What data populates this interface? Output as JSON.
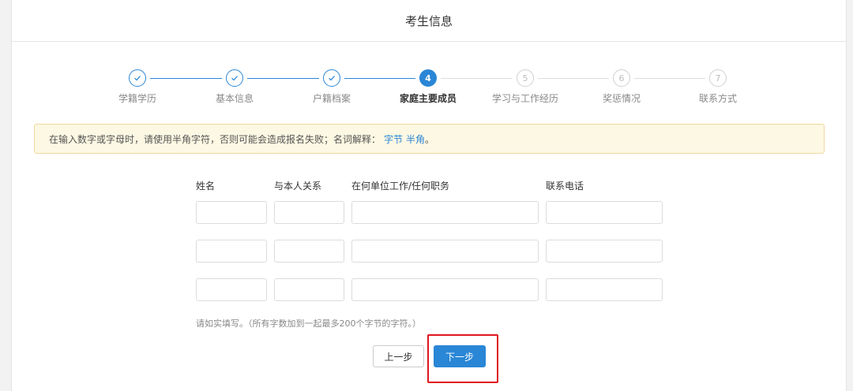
{
  "header": {
    "title": "考生信息"
  },
  "steps": [
    {
      "number": "1",
      "label": "学籍学历",
      "state": "done",
      "icon": "check-icon"
    },
    {
      "number": "2",
      "label": "基本信息",
      "state": "done",
      "icon": "check-icon"
    },
    {
      "number": "3",
      "label": "户籍档案",
      "state": "done",
      "icon": "check-icon"
    },
    {
      "number": "4",
      "label": "家庭主要成员",
      "state": "active"
    },
    {
      "number": "5",
      "label": "学习与工作经历",
      "state": "todo"
    },
    {
      "number": "6",
      "label": "奖惩情况",
      "state": "todo"
    },
    {
      "number": "7",
      "label": "联系方式",
      "state": "todo"
    }
  ],
  "notice": {
    "text": "在输入数字或字母时，请使用半角字符，否则可能会造成报名失败；名词解释：",
    "link1": "字节",
    "link2": "半角",
    "end": "。"
  },
  "table": {
    "columns": [
      "姓名",
      "与本人关系",
      "在何单位工作/任何职务",
      "联系电话"
    ],
    "rows": [
      [
        "",
        "",
        "",
        ""
      ],
      [
        "",
        "",
        "",
        ""
      ],
      [
        "",
        "",
        "",
        ""
      ]
    ]
  },
  "hint": "请如实填写。（所有字数加到一起最多200个字节的字符。）",
  "buttons": {
    "prev": "上一步",
    "next": "下一步"
  },
  "colors": {
    "accent": "#2a86d6",
    "highlight": "#e0161f",
    "notice_bg": "#fcf8e3"
  }
}
